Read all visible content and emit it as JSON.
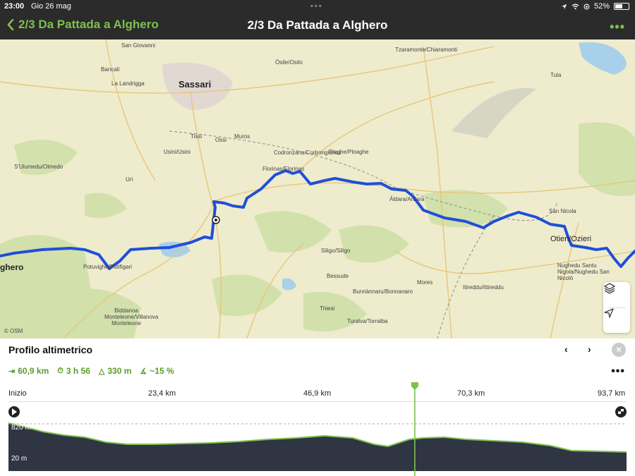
{
  "status_bar": {
    "time": "23:00",
    "date": "Gio 26 mag",
    "battery": "52%"
  },
  "nav": {
    "back_label": "2/3 Da Pattada a Alghero",
    "title": "2/3 Da Pattada a Alghero",
    "more_label": "•••"
  },
  "map": {
    "places": [
      "San Giovanni",
      "Bancali",
      "La Landrigga",
      "Sassari",
      "Tissi",
      "Ossi",
      "Muros",
      "Usini/Usini",
      "S'Ulumedu/Olmedo",
      "Uri",
      "Codronzanu/Codrongianos",
      "Florinas/Florinas",
      "Piaghe/Ploaghe",
      "Òsile/Osilo",
      "Tzaramonte/Chiaramonti",
      "Tula",
      "Àldara/Ardara",
      "San Nicola",
      "Otieri/Ozieri",
      "Nughedu Santu Nigola/Nughedu San Nicolò",
      "Siligo/Siligo",
      "Bessude",
      "Bunnànnaru/Bonnanaro",
      "Mores",
      "Itireddu/Ittireddu",
      "Thiesi",
      "Turalva/Torralba",
      "Potuvighe/Putifigari",
      "Biddanoa Monteleone/Villanova Monteleone",
      "ghero"
    ],
    "attribution": "© OSM",
    "route_color": "#1f4fd8"
  },
  "profile": {
    "title": "Profilo altimetrico",
    "prev_icon": "‹",
    "next_icon": "›",
    "close_icon": "×",
    "stats": {
      "distance": "60,9 km",
      "duration": "3 h 56",
      "ascent": "330 m",
      "grade": "~15 %"
    },
    "more_label": "•••",
    "distance_marks": [
      "Inizio",
      "23,4 km",
      "46,9 km",
      "70,3 km",
      "93,7 km"
    ],
    "elevation_max": "820 m",
    "elevation_min": "20 m",
    "cursor_km": 61.6,
    "total_km": 93.7,
    "colors": {
      "profile_fill": "#2f3542",
      "profile_line": "#7fc14c",
      "cursor": "#7fc14c"
    }
  }
}
